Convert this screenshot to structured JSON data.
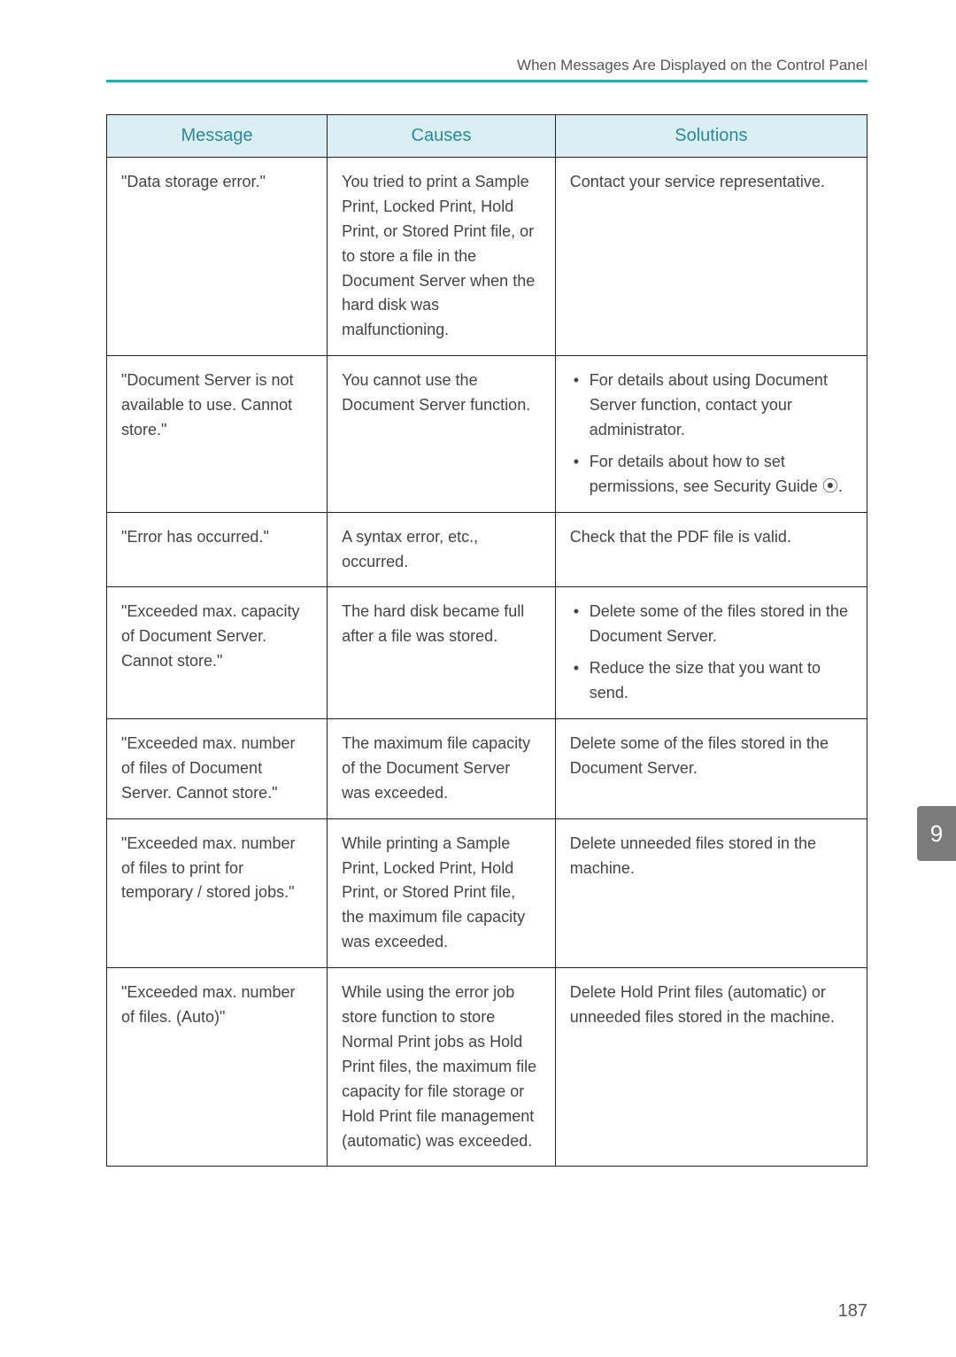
{
  "header": {
    "running_title": "When Messages Are Displayed on the Control Panel"
  },
  "table": {
    "headers": {
      "message": "Message",
      "causes": "Causes",
      "solutions": "Solutions"
    },
    "rows": [
      {
        "message": "\"Data storage error.\"",
        "causes": "You tried to print a Sample Print, Locked Print, Hold Print, or Stored Print file, or to store a file in the Document Server when the hard disk was malfunctioning.",
        "solutions_text": "Contact your service representative."
      },
      {
        "message": "\"Document Server is not available to use. Cannot store.\"",
        "causes": "You cannot use the Document Server function.",
        "solutions_list": [
          "For details about using Document Server function, contact your administrator.",
          "For details about how to set permissions, see Security Guide ⦿."
        ]
      },
      {
        "message": "\"Error has occurred.\"",
        "causes": "A syntax error, etc., occurred.",
        "solutions_text": "Check that the PDF file is valid."
      },
      {
        "message": "\"Exceeded max. capacity of Document Server. Cannot store.\"",
        "causes": "The hard disk became full after a file was stored.",
        "solutions_list": [
          "Delete some of the files stored in the Document Server.",
          "Reduce the size that you want to send."
        ]
      },
      {
        "message": "\"Exceeded max. number of files of Document Server. Cannot store.\"",
        "causes": "The maximum file capacity of the Document Server was exceeded.",
        "solutions_text": "Delete some of the files stored in the Document Server."
      },
      {
        "message": "\"Exceeded max. number of files to print for temporary / stored jobs.\"",
        "causes": "While printing a Sample Print, Locked Print, Hold Print, or Stored Print file, the maximum file capacity was exceeded.",
        "solutions_text": "Delete unneeded files stored in the machine."
      },
      {
        "message": "\"Exceeded max. number of files. (Auto)\"",
        "causes": "While using the error job store function to store Normal Print jobs as Hold Print files, the maximum file capacity for file storage or Hold Print file management (automatic) was exceeded.",
        "solutions_text": "Delete Hold Print files (automatic) or unneeded files stored in the machine."
      }
    ]
  },
  "side_tab": "9",
  "page_number": "187"
}
